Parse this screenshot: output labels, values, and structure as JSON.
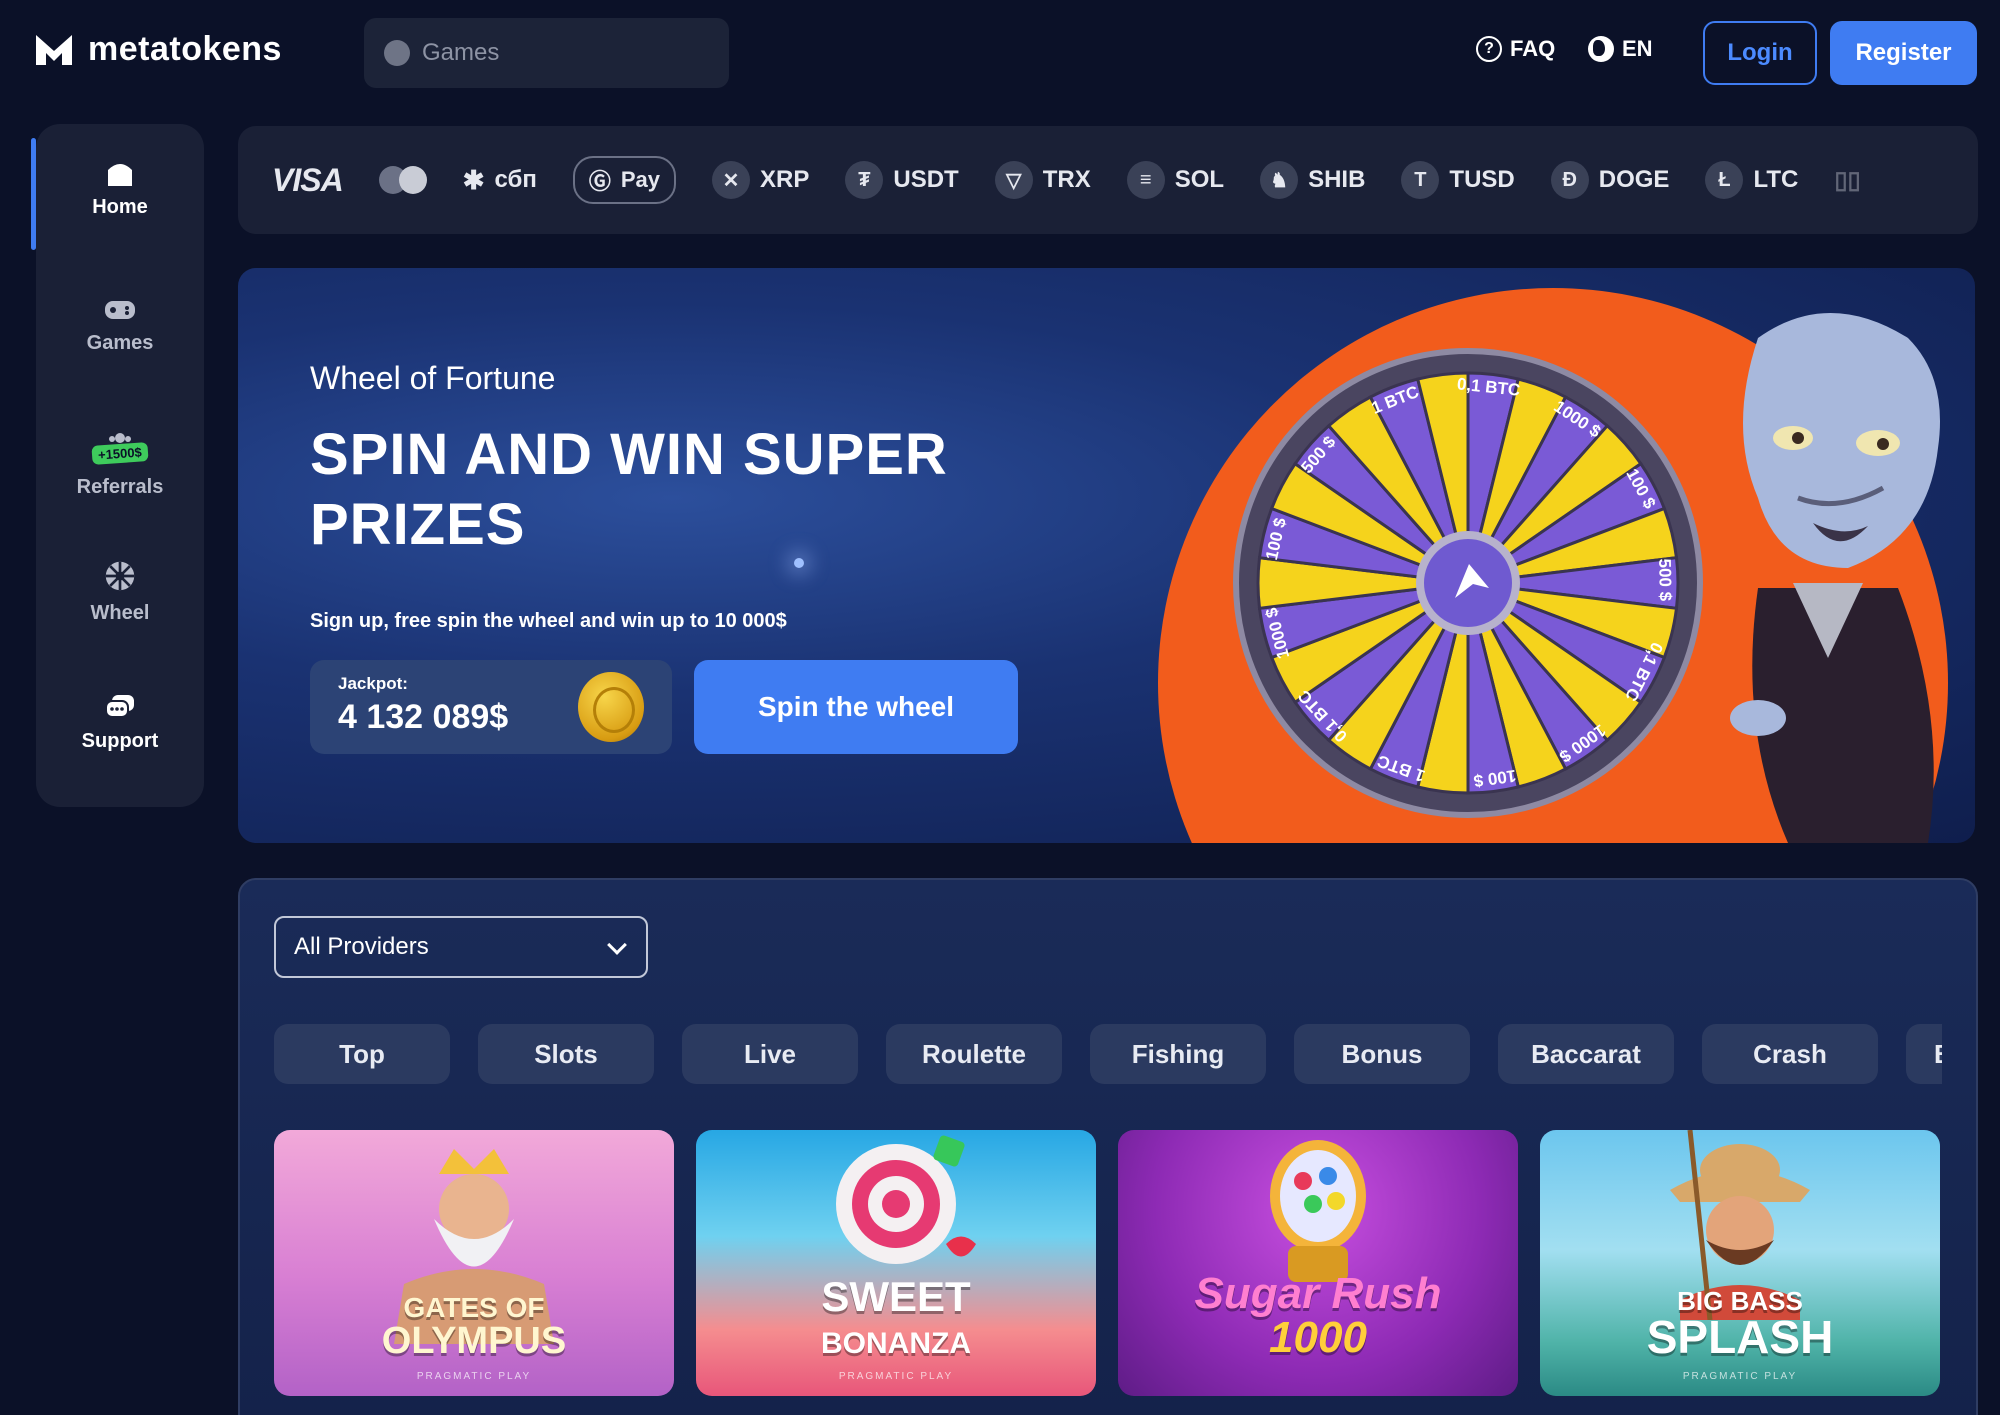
{
  "header": {
    "brand": "metatokens",
    "search_placeholder": "Games",
    "faq_label": "FAQ",
    "lang_label": "EN",
    "login_label": "Login",
    "register_label": "Register"
  },
  "sidebar": {
    "items": [
      {
        "label": "Home",
        "icon": "home-icon",
        "active": true
      },
      {
        "label": "Games",
        "icon": "gamepad-icon"
      },
      {
        "label": "Referrals",
        "icon": "referral-icon",
        "badge": "+1500$"
      },
      {
        "label": "Wheel",
        "icon": "wheel-icon"
      },
      {
        "label": "Support",
        "icon": "chat-icon"
      }
    ]
  },
  "payments": {
    "visa": "VISA",
    "sbp": "сбп",
    "pay": "Pay",
    "coins": [
      {
        "label": "XRP",
        "glyph": "✕"
      },
      {
        "label": "USDT",
        "glyph": "₮"
      },
      {
        "label": "TRX",
        "glyph": "▽"
      },
      {
        "label": "SOL",
        "glyph": "≡"
      },
      {
        "label": "SHIB",
        "glyph": "♞"
      },
      {
        "label": "TUSD",
        "glyph": "T"
      },
      {
        "label": "DOGE",
        "glyph": "Ð"
      },
      {
        "label": "LTC",
        "glyph": "Ł"
      }
    ]
  },
  "hero": {
    "subtitle": "Wheel of Fortune",
    "title": "SPIN AND WIN SUPER PRIZES",
    "description": "Sign up, free spin the wheel and win up to 10 000$",
    "jackpot_label": "Jackpot:",
    "jackpot_value": "4 132 089$",
    "cta_label": "Spin the wheel",
    "wheel_labels": [
      "0,1 BTC",
      "1000 $",
      "100 $",
      "500 $",
      "0,1 BTC",
      "1000 $",
      "100 $",
      "1 BTC",
      "0,1 BTC",
      "1000 $",
      "100 $",
      "500 $",
      "1 BTC"
    ]
  },
  "games": {
    "provider_select": "All Providers",
    "tabs": [
      "Top",
      "Slots",
      "Live",
      "Roulette",
      "Fishing",
      "Bonus",
      "Baccarat",
      "Crash",
      "Blackjack"
    ],
    "cards": [
      {
        "title_line1": "GATES OF",
        "title_line2": "OLYMPUS",
        "provider": "PRAGMATIC PLAY"
      },
      {
        "title_line1": "SWEET",
        "title_line2": "BONANZA",
        "provider": "PRAGMATIC PLAY"
      },
      {
        "title_line1": "Sugar Rush",
        "title_line2": "1000",
        "provider": ""
      },
      {
        "title_line1": "BIG BASS",
        "title_line2": "SPLASH",
        "provider": "PRAGMATIC PLAY"
      }
    ]
  },
  "colors": {
    "background": "#0b1128",
    "panel": "#1a2036",
    "accent": "#3f7cf2",
    "hero_orange": "#f25c1c",
    "wheel_purple": "#7a5ad6",
    "wheel_yellow": "#f5d31c"
  }
}
